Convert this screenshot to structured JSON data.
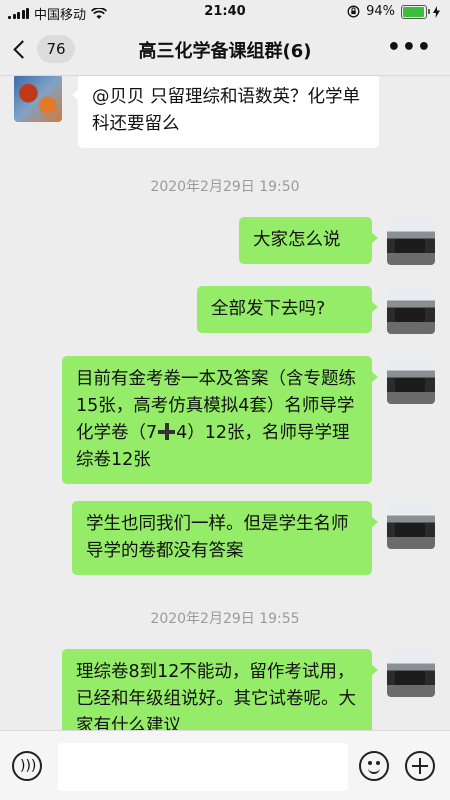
{
  "status_bar": {
    "carrier": "中国移动",
    "time": "21:40",
    "battery": "94%",
    "battery_level": 0.94
  },
  "header": {
    "back_count": "76",
    "title": "高三化学备课组群(6)",
    "more": "•••"
  },
  "messages": [
    {
      "side": "in",
      "text": "@贝贝 只留理综和语数英？化学单科还要留么"
    },
    {
      "timestamp": "2020年2月29日 19:50"
    },
    {
      "side": "out",
      "text": "大家怎么说"
    },
    {
      "side": "out",
      "text": "全部发下去吗?"
    },
    {
      "side": "out",
      "text_a": "目前有金考卷一本及答案（含专题练15张，高考仿真模拟4套）名师导学化学卷（7",
      "text_b": "4）12张，名师导学理综卷12张"
    },
    {
      "side": "out",
      "text": "学生也同我们一样。但是学生名师导学的卷都没有答案"
    },
    {
      "timestamp": "2020年2月29日 19:55"
    },
    {
      "side": "out",
      "text": "理综卷8到12不能动，留作考试用，已经和年级组说好。其它试卷呢。大家有什么建议"
    }
  ],
  "input_bar": {
    "voice_icon": "voice-icon",
    "emoji_icon": "emoji-icon",
    "add_icon": "plus-circle-icon"
  }
}
